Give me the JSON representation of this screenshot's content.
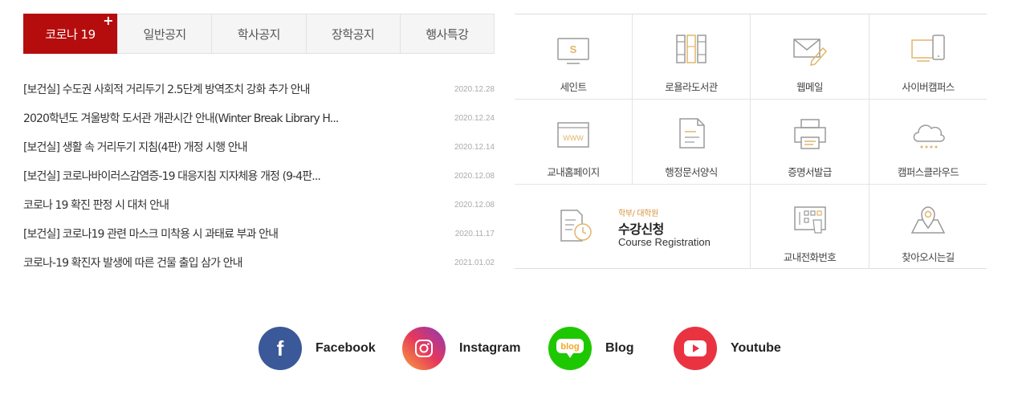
{
  "tabs": [
    {
      "label": "코로나 19"
    },
    {
      "label": "일반공지"
    },
    {
      "label": "학사공지"
    },
    {
      "label": "장학공지"
    },
    {
      "label": "행사특강"
    }
  ],
  "more_label": "+",
  "notices": [
    {
      "title": "[보건실] 수도권 사회적 거리두기 2.5단계 방역조치 강화 추가 안내",
      "date": "2020.12.28"
    },
    {
      "title": "2020학년도 겨울방학 도서관 개관시간 안내(Winter Break Library H...",
      "date": "2020.12.24"
    },
    {
      "title": "[보건실] 생활 속 거리두기 지침(4판) 개정 시행 안내",
      "date": "2020.12.14"
    },
    {
      "title": "[보건실] 코로나바이러스감염증-19 대응지침 지자체용 개정 (9-4판...",
      "date": "2020.12.08"
    },
    {
      "title": "코로나 19 확진 판정 시 대처 안내",
      "date": "2020.12.08"
    },
    {
      "title": "[보건실] 코로나19 관련 마스크 미착용 시 과태료 부과 안내",
      "date": "2020.11.17"
    },
    {
      "title": "코로나-19 확진자 발생에 따른 건물 출입 삼가 안내",
      "date": "2021.01.02"
    }
  ],
  "quick_menu": [
    {
      "label": "세인트",
      "icon": "monitor-s-icon"
    },
    {
      "label": "로욜라도서관",
      "icon": "bookshelf-icon"
    },
    {
      "label": "웹메일",
      "icon": "mail-pen-icon"
    },
    {
      "label": "사이버캠퍼스",
      "icon": "devices-icon"
    },
    {
      "label": "교내홈페이지",
      "icon": "www-browser-icon"
    },
    {
      "label": "행정문서양식",
      "icon": "document-icon"
    },
    {
      "label": "증명서발급",
      "icon": "printer-icon"
    },
    {
      "label": "캠퍼스클라우드",
      "icon": "cloud-icon"
    },
    {
      "label": "교내전화번호",
      "icon": "phone-directory-icon"
    },
    {
      "label": "찾아오시는길",
      "icon": "map-pin-icon"
    }
  ],
  "course": {
    "sub": "학부/ 대학원",
    "title": "수강신청",
    "english": "Course Registration",
    "icon": "document-clock-icon"
  },
  "sns": [
    {
      "label": "Facebook",
      "icon": "facebook-icon",
      "color": "#3b5998"
    },
    {
      "label": "Instagram",
      "icon": "instagram-icon",
      "color": "#c13584"
    },
    {
      "label": "Blog",
      "icon": "blog-bubble-icon",
      "color": "#1ec800"
    },
    {
      "label": "Youtube",
      "icon": "youtube-icon",
      "color": "#ea3341"
    }
  ],
  "colors": {
    "accent": "#b50d0d",
    "icon_gray": "#9a9a9a",
    "icon_gold": "#e0b56a"
  }
}
